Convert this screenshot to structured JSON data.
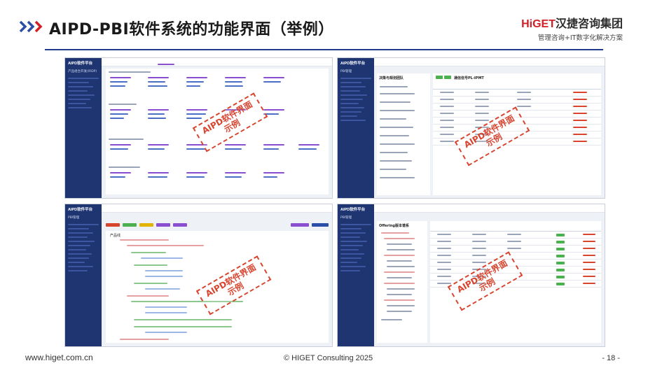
{
  "slide": {
    "title": "AIPD-PBI软件系统的功能界面（举例）",
    "logo_brand_red": "HiGET",
    "logo_brand_text": "汉捷咨询集团",
    "logo_tagline": "管理咨询+IT数字化解决方案",
    "footer_website": "www.higet.com.cn",
    "footer_copyright": "©  HIGET Consulting   2025",
    "page_number": "- 18 -"
  },
  "screenshots": [
    {
      "app_title": "AIPD软件平台",
      "module": "产品组合开发(IRDP)",
      "stamp_line1": "AIPD软件界面",
      "stamp_line2": "示例"
    },
    {
      "app_title": "AIPD软件平台",
      "module": "PBI管理",
      "panel_title": "决策与规划团队",
      "table_title": "通信信号PL-IPMT",
      "stamp_line1": "AIPD软件界面",
      "stamp_line2": "示例"
    },
    {
      "app_title": "AIPD软件平台",
      "module": "PBI管理",
      "tree_root": "产品线",
      "stamp_line1": "AIPD软件界面",
      "stamp_line2": "示例"
    },
    {
      "app_title": "AIPD软件平台",
      "module": "PBI管理",
      "panel_title": "Offering版本谱系",
      "stamp_line1": "AIPD软件界面",
      "stamp_line2": "示例"
    }
  ],
  "colors": {
    "accent_blue": "#1f3a8a",
    "accent_red": "#d11f26",
    "sidebar": "#1e3572",
    "stamp": "#d8452f"
  },
  "icons": [
    "triple-chevron-icon"
  ]
}
